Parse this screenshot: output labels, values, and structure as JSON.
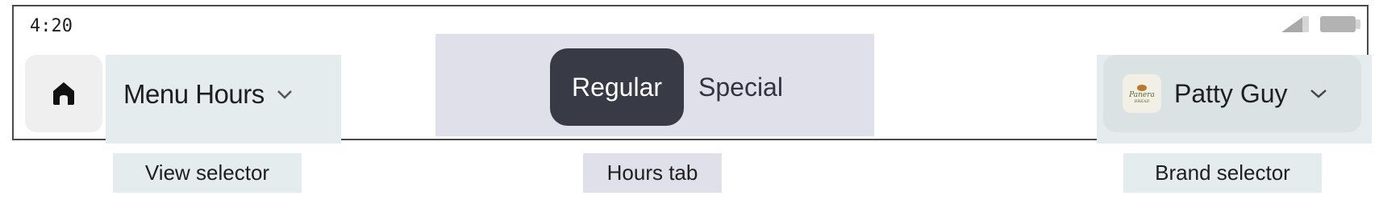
{
  "status_bar": {
    "time": "4:20",
    "signal_icon": "cell-signal-icon",
    "battery_icon": "battery-icon"
  },
  "home": {
    "icon": "home-icon"
  },
  "view_selector": {
    "label": "Menu Hours",
    "icon": "chevron-down-icon"
  },
  "hours_tabs": {
    "tabs": [
      {
        "label": "Regular",
        "selected": true
      },
      {
        "label": "Special",
        "selected": false
      }
    ]
  },
  "brand_selector": {
    "logo_text": "Panera",
    "logo_subtext": "BREAD",
    "name": "Patty Guy",
    "icon": "chevron-down-icon"
  },
  "annotations": {
    "view": "View selector",
    "hours": "Hours tab",
    "brand": "Brand selector"
  },
  "colors": {
    "selected_tab_bg": "#383a46",
    "view_region_bg": "#e5ecee",
    "tab_region_bg": "#dfe0ea",
    "brand_button_bg": "#dbe2e3"
  }
}
